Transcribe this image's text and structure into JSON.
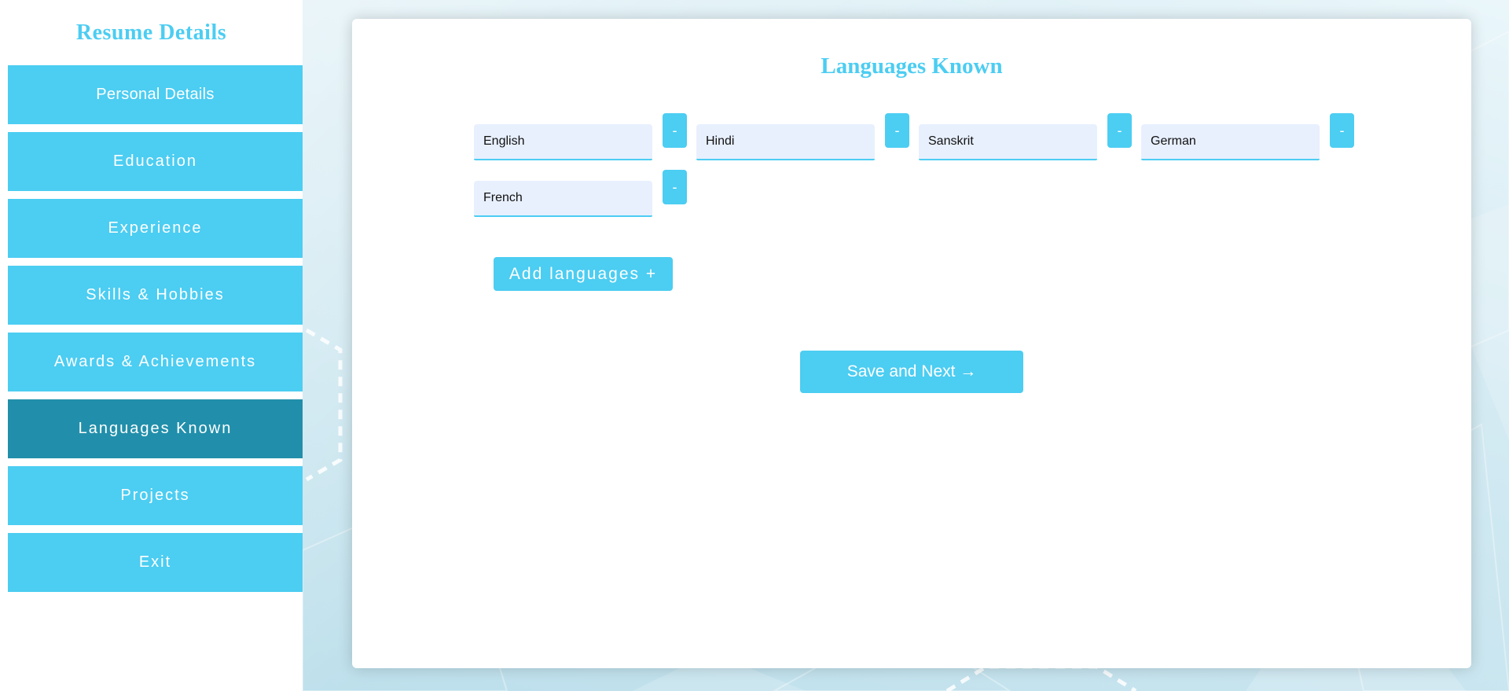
{
  "sidebar": {
    "title": "Resume Details",
    "items": [
      {
        "label": "Personal Details",
        "active": false
      },
      {
        "label": "Education",
        "active": false
      },
      {
        "label": "Experience",
        "active": false
      },
      {
        "label": "Skills & Hobbies",
        "active": false
      },
      {
        "label": "Awards & Achievements",
        "active": false
      },
      {
        "label": "Languages Known",
        "active": true
      },
      {
        "label": "Projects",
        "active": false
      },
      {
        "label": "Exit",
        "active": false
      }
    ]
  },
  "main": {
    "title": "Languages Known",
    "languages": [
      {
        "value": "English",
        "remove_label": "-"
      },
      {
        "value": "Hindi",
        "remove_label": "-"
      },
      {
        "value": "Sanskrit",
        "remove_label": "-"
      },
      {
        "value": "German",
        "remove_label": "-"
      },
      {
        "value": "French",
        "remove_label": "-"
      }
    ],
    "add_button_label": "Add languages +",
    "save_button_label": "Save and Next →"
  },
  "colors": {
    "accent": "#4ccdf2",
    "active_nav": "#218fab",
    "input_bg": "#e8f0fe"
  }
}
